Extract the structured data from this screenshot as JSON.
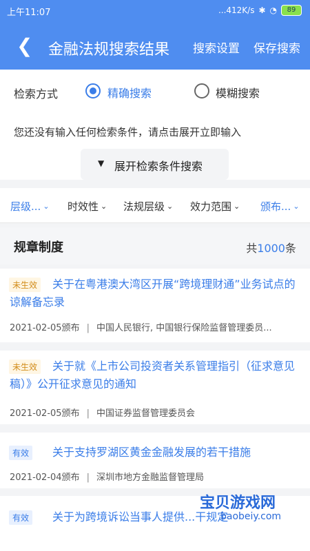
{
  "status_bar": {
    "time": "上午11:07",
    "network_speed": "...412K/s",
    "battery": "89"
  },
  "header": {
    "back_icon": "chevron-left-icon",
    "title": "金融法规搜索结果",
    "actions": [
      "搜索设置",
      "保存搜索"
    ],
    "color": "#4f8df0"
  },
  "search_mode": {
    "label": "检索方式",
    "options": [
      {
        "label": "精确搜索",
        "selected": true
      },
      {
        "label": "模糊搜索",
        "selected": false
      }
    ]
  },
  "hint": "您还没有输入任何检索条件，请点击展开立即输入",
  "expand_button": "展开检索条件搜索",
  "filters": [
    "层级...",
    "时效性",
    "法规层级",
    "效力范围",
    "颁布..."
  ],
  "section": {
    "title": "规章制度",
    "count_prefix": "共",
    "count": "1000",
    "count_suffix": "条"
  },
  "items": [
    {
      "badge": "未生效",
      "title": "关于在粤港澳大湾区开展“跨境理财通”业务试点的谅解备忘录",
      "date": "2021-02-05颁布",
      "issuer": "中国人民银行, 中国银行保险监督管理委员..."
    },
    {
      "badge": "未生效",
      "title": "关于就《上市公司投资者关系管理指引（征求意见稿）》公开征求意见的通知",
      "date": "2021-02-05颁布",
      "issuer": "中国证券监督管理委员会"
    },
    {
      "badge": "有效",
      "title": "关于支持罗湖区黄金金融发展的若干措施",
      "date": "2021-02-04颁布",
      "issuer": "深圳市地方金融监督管理局"
    },
    {
      "badge": "有效",
      "title": "关于为跨境诉讼当事人提供...干规定",
      "date": "",
      "issuer": ""
    }
  ],
  "watermark": {
    "text": "宝贝游戏网",
    "site": "baobeiy.com"
  }
}
